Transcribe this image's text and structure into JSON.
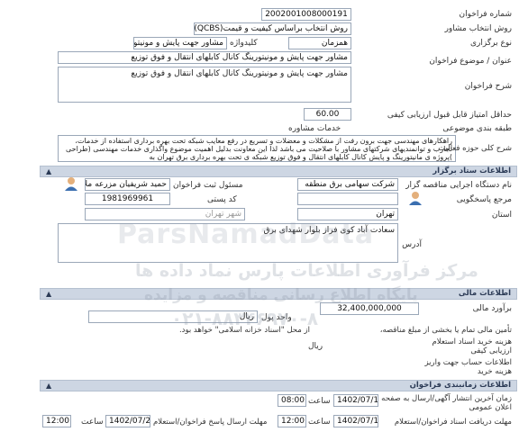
{
  "form": {
    "tender_number_label": "شماره فراخوان",
    "tender_number": "2002001008000191",
    "method_label": "روش انتخاب مشاور",
    "method": "روش انتخاب براساس کیفیت و قیمت(QCBS)",
    "type_label": "نوع برگزاری",
    "type": "همزمان",
    "keyword_label": "کلیدواژه",
    "keyword": "مشاور جهت پایش و مونیتور",
    "title_label": "عنوان / موضوع فراخوان",
    "title": "مشاور جهت پایش و مونیتورینگ کانال کابلهای انتقال و فوق توزیع",
    "description_label": "شرح فراخوان",
    "description": "مشاور جهت پایش و مونیتورینگ کانال کابلهای انتقال و فوق توزیع",
    "min_score_label": "حداقل امتیاز قابل قبول ارزیابی کیفی",
    "min_score": "60.00",
    "category_label": "طبقه بندی موضوعی",
    "category": "خدمات مشاوره",
    "scope_label": "شرح کلی حوزه فعالیت",
    "scope": "راهکارهای مهندسی جهت برون رفت از مشکلات و معضلات و تسریع در رفع معایب شبکه تحت بهره برداری استفاده از خدمات، تجارب و توانمندیهای شرکتهای مشاور با صلاحیت می باشد لذا این معاونت بدلیل اهمیت موضوع واگذاری خدمات مهندسی (طراحی )پروژه ی مانیتورینگ و پایش کانال کابلهای انتقال و فوق توزیع شبکه ی تحت بهره برداری برق تهران به"
  },
  "organizer": {
    "section_title": "اطلاعات ستاد برگزار",
    "agency_label": "نام دستگاه اجرایی مناقصه گزار",
    "agency": "شرکت سهامی برق منطقه",
    "registrar_label": "مسئول ثبت فراخوان",
    "registrar": "حمید شریفیان مزرعه ملا",
    "respondent_label": "مرجع پاسخگویی",
    "postal_label": "کد پستی",
    "postal": "1981969961",
    "province_label": "استان",
    "province": "تهران",
    "city_label": "شهر تهران",
    "address_label": "آدرس",
    "address": "سعادت آباد کوی فراز بلوار شهدای برق"
  },
  "financial": {
    "section_title": "اطلاعات مالی",
    "estimate_label": "برآورد مالی",
    "estimate": "32,400,000,000",
    "currency_label": "واحد پول",
    "currency": "ریال",
    "guarantee_note": "از محل \"اسناد خزانه اسلامی\" خواهد بود.",
    "guarantee_prefix": "تأمین مالی تمام یا بخشی از مبلغ مناقصه،",
    "doc_price_label": "هزینه خرید اسناد استعلام ارزیابی کیفی",
    "doc_price_unit": "ریال",
    "account_label": "اطلاعات حساب جهت واریز هزینه خرید"
  },
  "timing": {
    "section_title": "اطلاعات زمانبندی فراخوان",
    "publish_label": "زمان آخرین انتشار آگهی/ارسال به صفحه اعلان عمومی",
    "publish_date": "1402/07/10",
    "publish_time": "08:00",
    "time_label": "ساعت",
    "receive_label": "مهلت دریافت اسناد فراخوان/استعلام",
    "receive_date": "1402/07/13",
    "receive_time": "12:00",
    "submit_label": "مهلت ارسال پاسخ فراخوان/استعلام",
    "submit_date": "1402/07/20",
    "submit_time": "12:00"
  },
  "watermark": {
    "line1": "مرکز فرآوری اطلاعات پارس نماد داده ها",
    "line2": "پایگاه اطلاع رسانی مناقصه و مزایده",
    "phone": "۰۲۱-۸۸۳۴۶۹۷۰-۸",
    "site": "ParsNamadData"
  }
}
